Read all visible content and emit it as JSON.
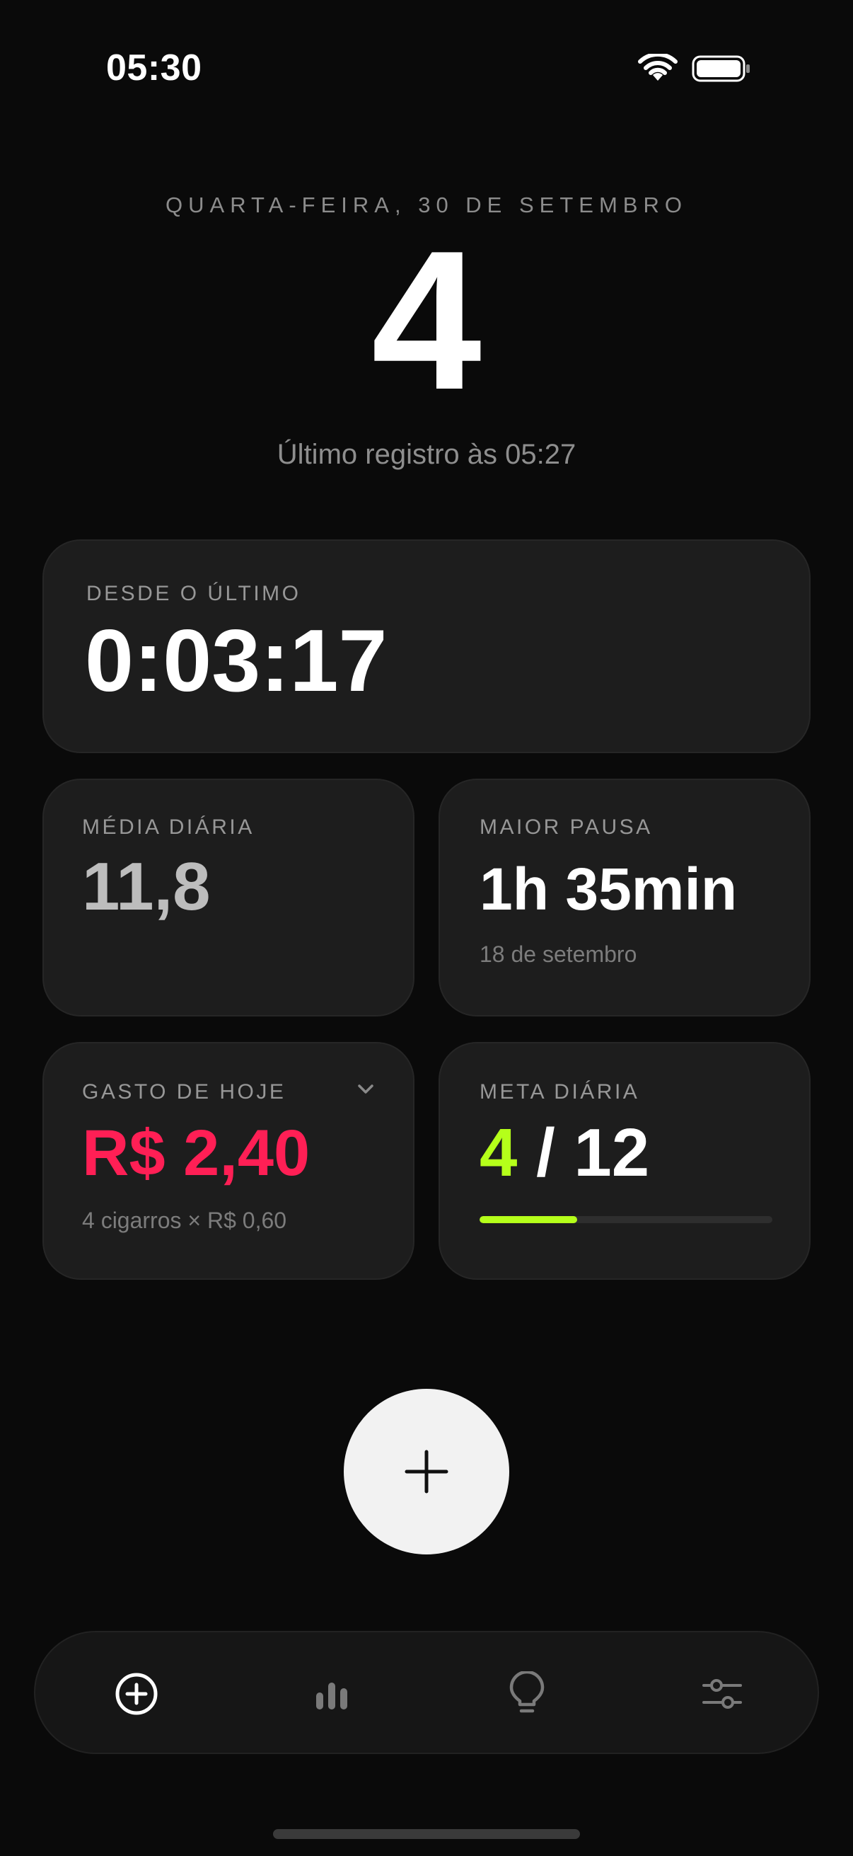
{
  "status_bar": {
    "time": "05:30",
    "wifi_icon": "wifi-icon",
    "battery_icon": "battery-icon"
  },
  "header": {
    "date": "QUARTA-FEIRA, 30 DE SETEMBRO",
    "count": "4",
    "last_record": "Último registro às 05:27"
  },
  "since_last": {
    "label": "DESDE O ÚLTIMO",
    "value": "0:03:17"
  },
  "daily_average": {
    "label": "MÉDIA DIÁRIA",
    "value": "11,8"
  },
  "longest_pause": {
    "label": "MAIOR PAUSA",
    "value": "1h 35min",
    "date": "18 de setembro"
  },
  "spend_today": {
    "label": "GASTO DE HOJE",
    "value": "R$ 2,40",
    "detail": "4 cigarros × R$ 0,60",
    "expand_icon": "chevron-down-icon"
  },
  "daily_goal": {
    "label": "META DIÁRIA",
    "current": "4",
    "separator": " / ",
    "target": "12",
    "progress_fraction": 0.333
  },
  "add_button": {
    "icon": "plus-icon"
  },
  "tabs": [
    {
      "icon": "add-circle-icon",
      "active": true
    },
    {
      "icon": "bar-chart-icon",
      "active": false
    },
    {
      "icon": "lightbulb-icon",
      "active": false
    },
    {
      "icon": "sliders-icon",
      "active": false
    }
  ],
  "colors": {
    "background": "#0a0a0a",
    "card": "#1d1d1d",
    "accent_green": "#b5ff1a",
    "accent_red": "#ff1f55",
    "button": "#f2f2f2"
  }
}
